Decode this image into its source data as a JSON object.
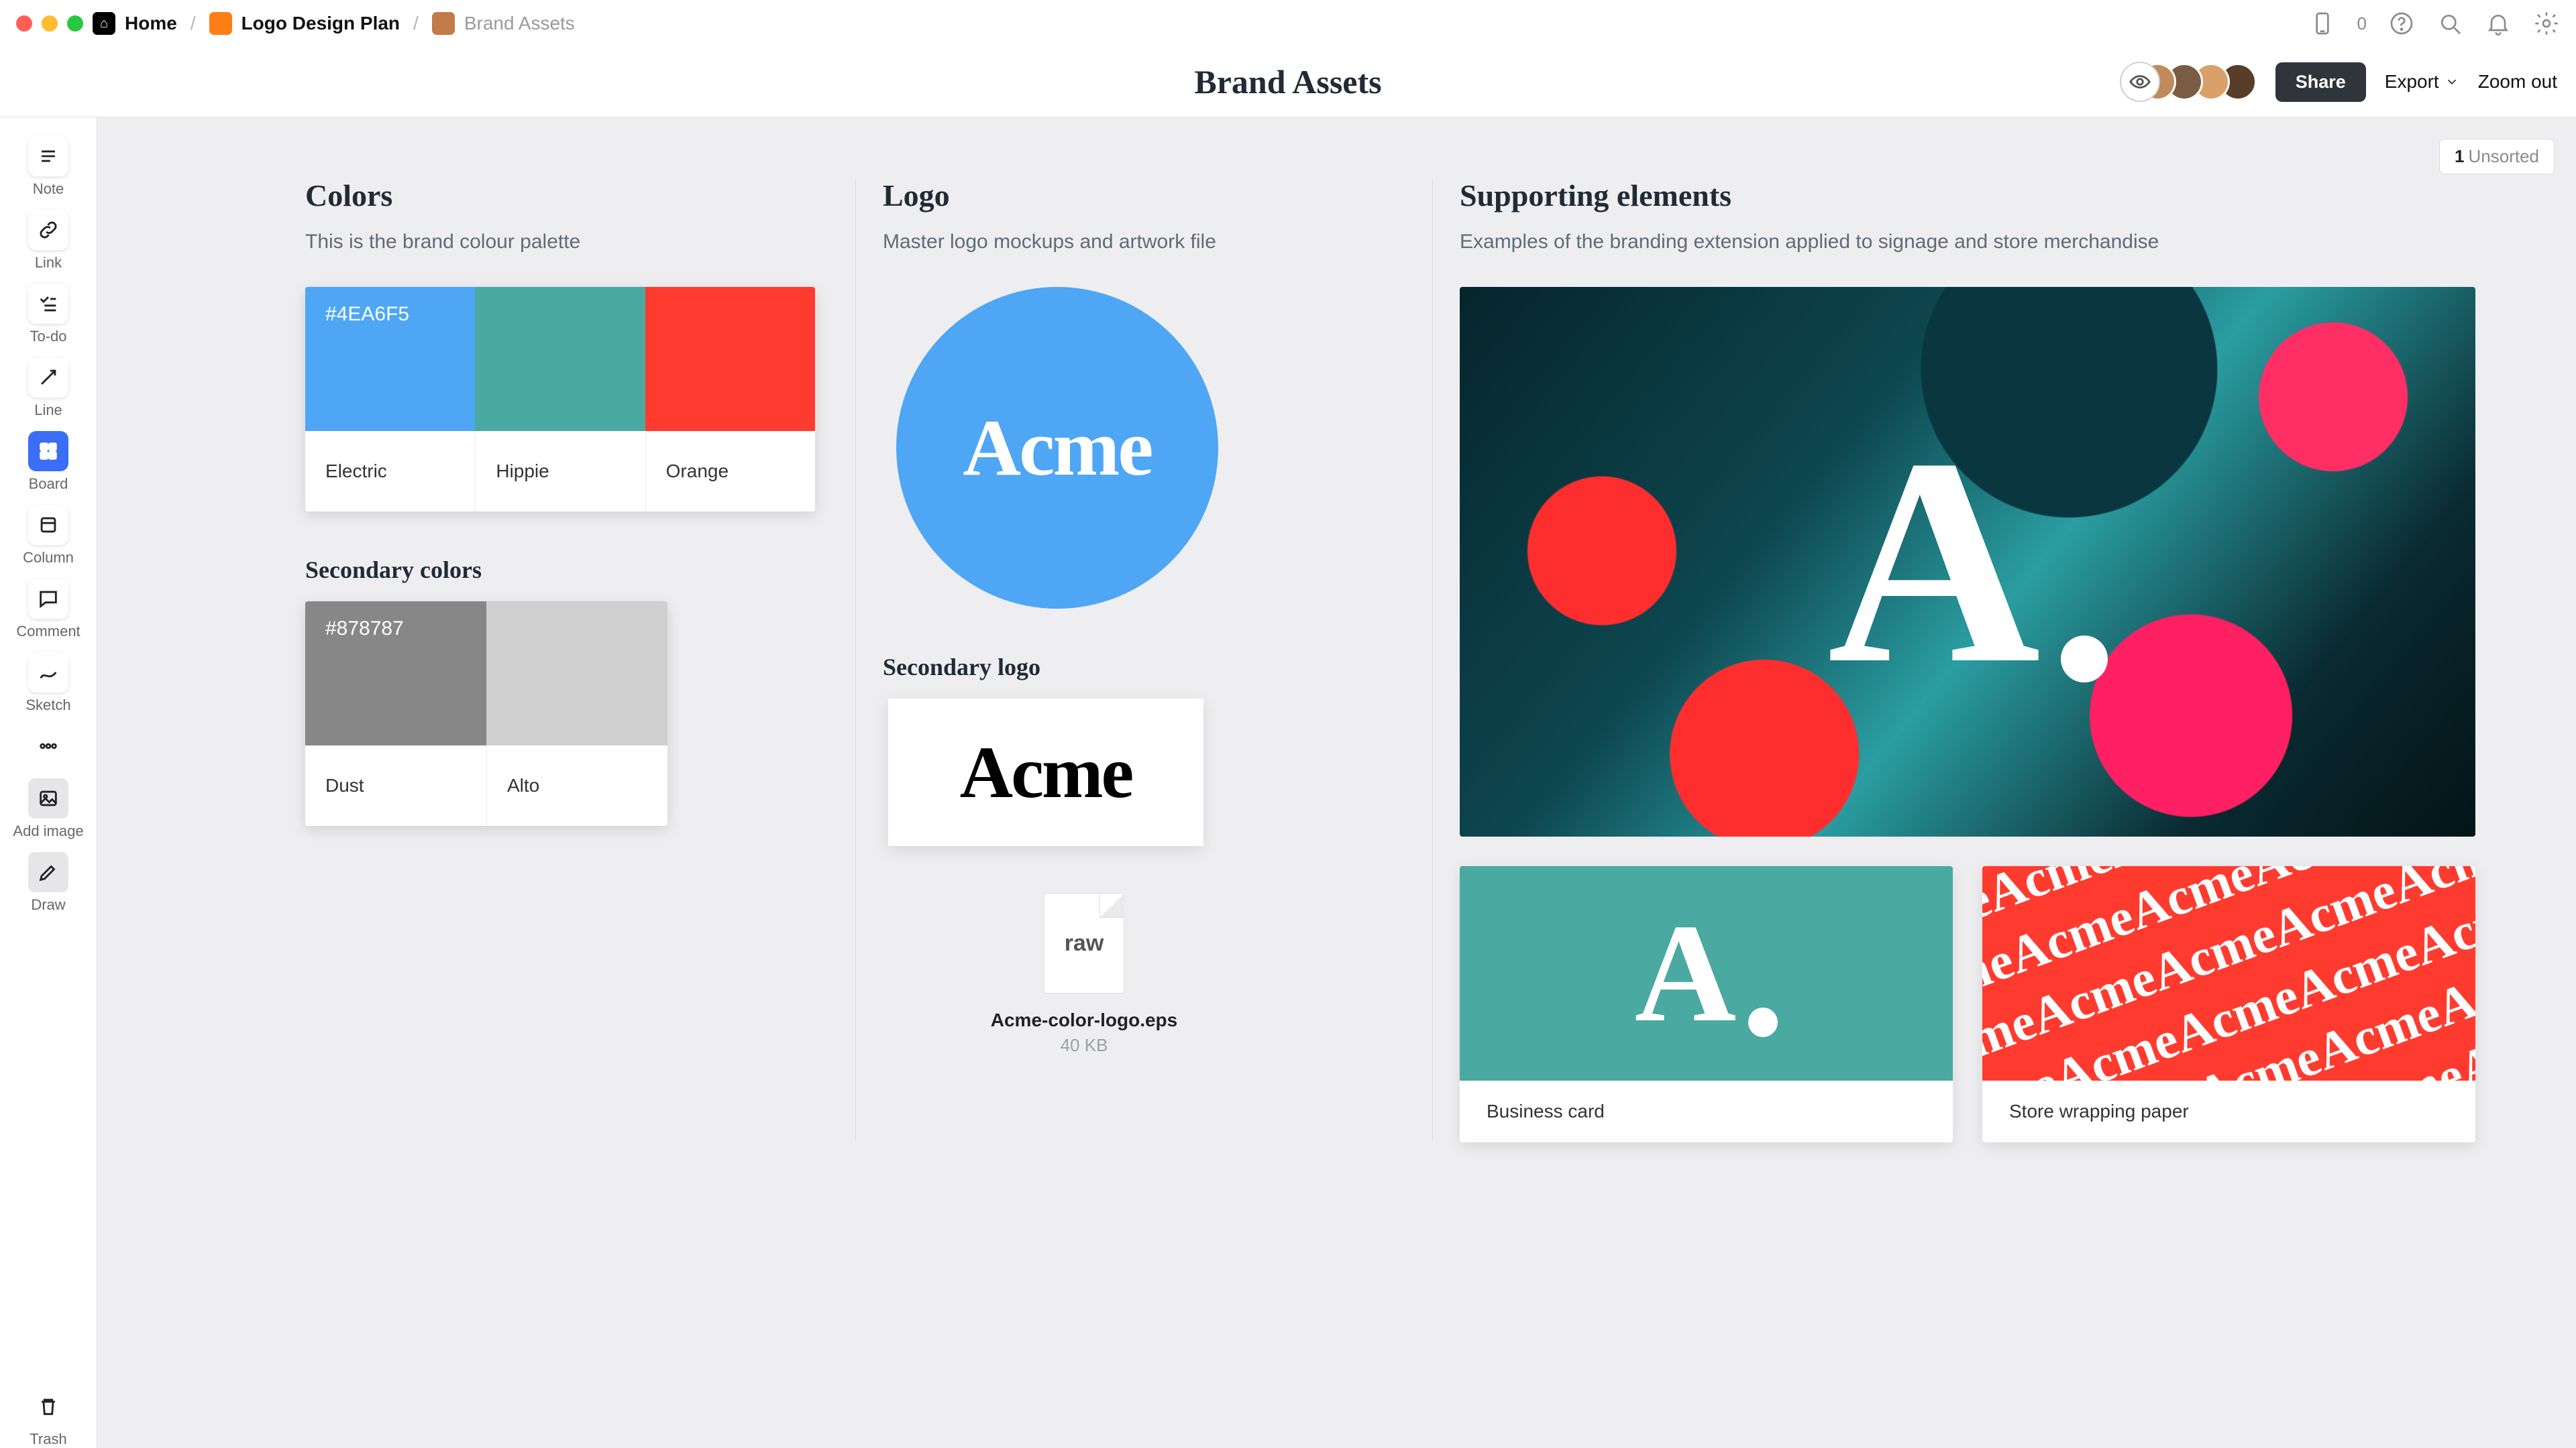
{
  "breadcrumbs": {
    "home": "Home",
    "project": "Logo Design Plan",
    "page": "Brand Assets"
  },
  "device_count": "0",
  "page_title": "Brand Assets",
  "toolbar": {
    "share": "Share",
    "export": "Export",
    "zoom_out": "Zoom out"
  },
  "unsorted": {
    "count": "1",
    "label": "Unsorted"
  },
  "sidebar": {
    "note": "Note",
    "link": "Link",
    "todo": "To-do",
    "line": "Line",
    "board": "Board",
    "column": "Column",
    "comment": "Comment",
    "sketch": "Sketch",
    "add_image": "Add image",
    "draw": "Draw",
    "trash": "Trash"
  },
  "colors": {
    "heading": "Colors",
    "sub": "This is the brand colour palette",
    "primary": [
      {
        "hex": "#4EA6F5",
        "name": "Electric"
      },
      {
        "hex": "#4AA9A0",
        "name": "Hippie"
      },
      {
        "hex": "#FF3B2F",
        "name": "Orange"
      }
    ],
    "secondary_heading": "Secondary colors",
    "secondary": [
      {
        "hex": "#878787",
        "name": "Dust"
      },
      {
        "hex": "#CFCFCF",
        "name": "Alto"
      }
    ]
  },
  "logo": {
    "heading": "Logo",
    "sub": "Master logo mockups and artwork file",
    "brand": "Acme",
    "secondary_heading": "Secondary logo",
    "file_name": "Acme-color-logo.eps",
    "file_size": "40 KB",
    "file_tag": "raw"
  },
  "support": {
    "heading": "Supporting elements",
    "sub": "Examples of the branding extension applied to signage and store merchandise",
    "card1": "Business card",
    "card2": "Store wrapping paper",
    "pattern_word": "Acme"
  }
}
